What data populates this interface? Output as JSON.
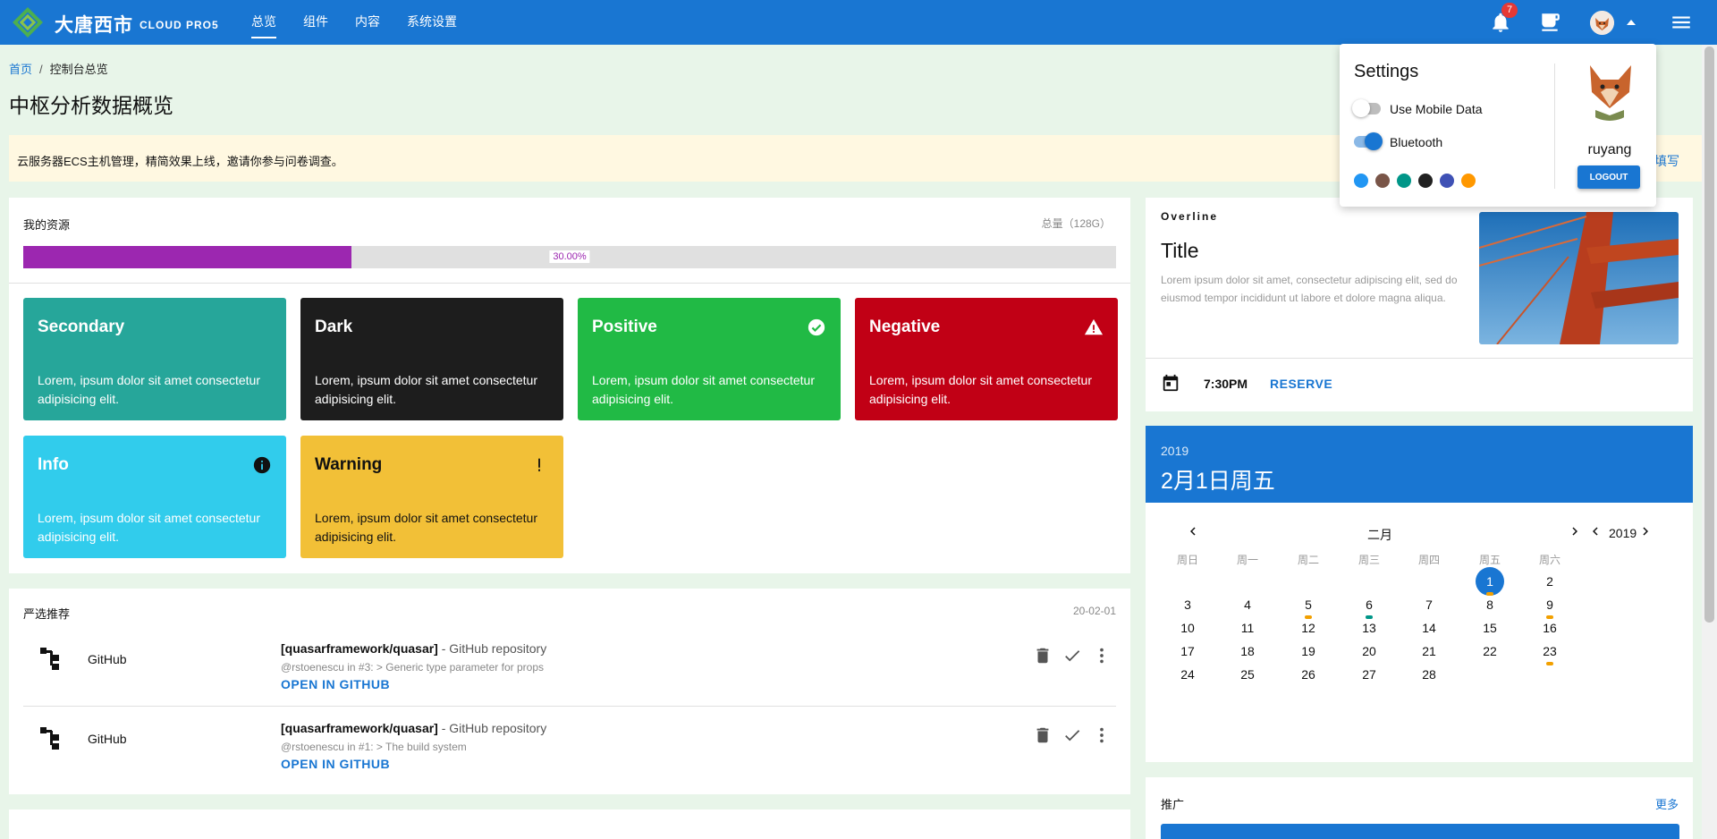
{
  "header": {
    "brand": "大唐西市",
    "brand_sub": "CLOUD PRO5",
    "nav": [
      "总览",
      "组件",
      "内容",
      "系统设置"
    ],
    "active_nav": 0,
    "notification_count": "7",
    "colors": {
      "primary": "#1976d2"
    }
  },
  "breadcrumb": {
    "home": "首页",
    "sep": "/",
    "current": "控制台总览"
  },
  "page_title": "中枢分析数据概览",
  "notice": {
    "text": "云服务器ECS主机管理，精简效果上线，邀请你参与问卷调查。",
    "link": "填写"
  },
  "resources": {
    "label": "我的资源",
    "total": "总量（128G）",
    "progress_percent": 30,
    "progress_text": "30.00%",
    "tiles": [
      {
        "title": "Secondary",
        "text": "Lorem, ipsum dolor sit amet consectetur adipisicing elit.",
        "color": "#26a69a",
        "icon": ""
      },
      {
        "title": "Dark",
        "text": "Lorem, ipsum dolor sit amet consectetur adipisicing elit.",
        "color": "#1d1d1d",
        "icon": ""
      },
      {
        "title": "Positive",
        "text": "Lorem, ipsum dolor sit amet consectetur adipisicing elit.",
        "color": "#21ba45",
        "icon": "check-circle-icon"
      },
      {
        "title": "Negative",
        "text": "Lorem, ipsum dolor sit amet consectetur adipisicing elit.",
        "color": "#c10015",
        "icon": "warning-icon"
      },
      {
        "title": "Info",
        "text": "Lorem, ipsum dolor sit amet consectetur adipisicing elit.",
        "color": "#31ccec",
        "icon": "info-icon"
      },
      {
        "title": "Warning",
        "text": "Lorem, ipsum dolor sit amet consectetur adipisicing elit.",
        "color": "#f2c037",
        "icon": "exclamation-icon"
      }
    ]
  },
  "recommend": {
    "title": "严选推荐",
    "date": "20-02-01",
    "items": [
      {
        "source": "GitHub",
        "repo": "[quasarframework/quasar]",
        "repo_sub": " - GitHub repository",
        "meta": "@rstoenescu in #3: > Generic type parameter for props",
        "link": "OPEN IN GITHUB"
      },
      {
        "source": "GitHub",
        "repo": "[quasarframework/quasar]",
        "repo_sub": " - GitHub repository",
        "meta": "@rstoenescu in #1: > The build system",
        "link": "OPEN IN GITHUB"
      }
    ]
  },
  "overline_card": {
    "overline": "Overline",
    "title": "Title",
    "body": "Lorem ipsum dolor sit amet, consectetur adipiscing elit, sed do eiusmod tempor incididunt ut labore et dolore magna aliqua.",
    "time": "7:30PM",
    "action": "RESERVE"
  },
  "calendar": {
    "year": "2019",
    "date_label": "2月1日周五",
    "month": "二月",
    "nav_year": "2019",
    "weekdays": [
      "周日",
      "周一",
      "周二",
      "周三",
      "周四",
      "周五",
      "周六"
    ],
    "days": [
      "1",
      "2",
      "3",
      "4",
      "5",
      "6",
      "7",
      "8",
      "9",
      "10",
      "11",
      "12",
      "13",
      "14",
      "15",
      "16",
      "17",
      "18",
      "19",
      "20",
      "21",
      "22",
      "23",
      "24",
      "25",
      "26",
      "27",
      "28"
    ],
    "first_weekday": 5,
    "selected": 1,
    "events": [
      {
        "day": 1,
        "color": "#f2a000"
      },
      {
        "day": 5,
        "color": "#f2a000"
      },
      {
        "day": 6,
        "color": "#009688"
      },
      {
        "day": 9,
        "color": "#f2a000"
      },
      {
        "day": 23,
        "color": "#f2a000"
      }
    ]
  },
  "promo": {
    "title": "推广",
    "more": "更多"
  },
  "settings_popup": {
    "title": "Settings",
    "toggles": [
      {
        "label": "Use Mobile Data",
        "on": false
      },
      {
        "label": "Bluetooth",
        "on": true
      }
    ],
    "swatches": [
      "#2196f3",
      "#795548",
      "#009688",
      "#212121",
      "#3f51b5",
      "#ff9800"
    ],
    "username": "ruyang",
    "logout": "LOGOUT"
  }
}
